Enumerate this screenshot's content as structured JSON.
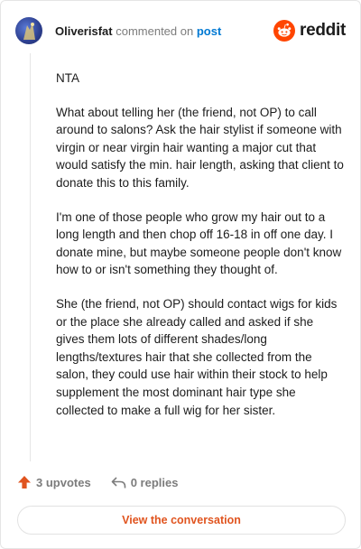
{
  "header": {
    "username": "Oliverisfat",
    "action_text": "commented on",
    "post_link": "post",
    "brand": "reddit"
  },
  "comment": {
    "paragraphs": [
      "NTA",
      "What about telling her (the friend, not OP) to call around to salons? Ask the hair stylist if someone with virgin or near virgin hair wanting a major cut that would satisfy the min. hair length, asking that client to donate this to this family.",
      "I'm one of those people who grow my hair out to a long length and then chop off 16-18 in off one day. I donate mine, but maybe someone people don't know how to or isn't something they thought of.",
      "She (the friend, not OP) should contact wigs for kids or the place she already called and asked if she gives them lots of different shades/long lengths/textures hair that she collected from the salon, they could use hair within their stock to help supplement the most dominant hair type she collected to make a full wig for her sister."
    ]
  },
  "actions": {
    "upvotes": "3 upvotes",
    "replies": "0 replies"
  },
  "cta": {
    "label": "View the conversation"
  },
  "colors": {
    "accent": "#e0541f",
    "link": "#0079d3",
    "reddit_orange": "#ff4500",
    "muted": "#7c7c7c"
  },
  "icons": {
    "avatar": "user-avatar",
    "logo": "reddit-snoo-icon",
    "upvote": "upvote-arrow-icon",
    "reply": "reply-arrow-icon"
  }
}
